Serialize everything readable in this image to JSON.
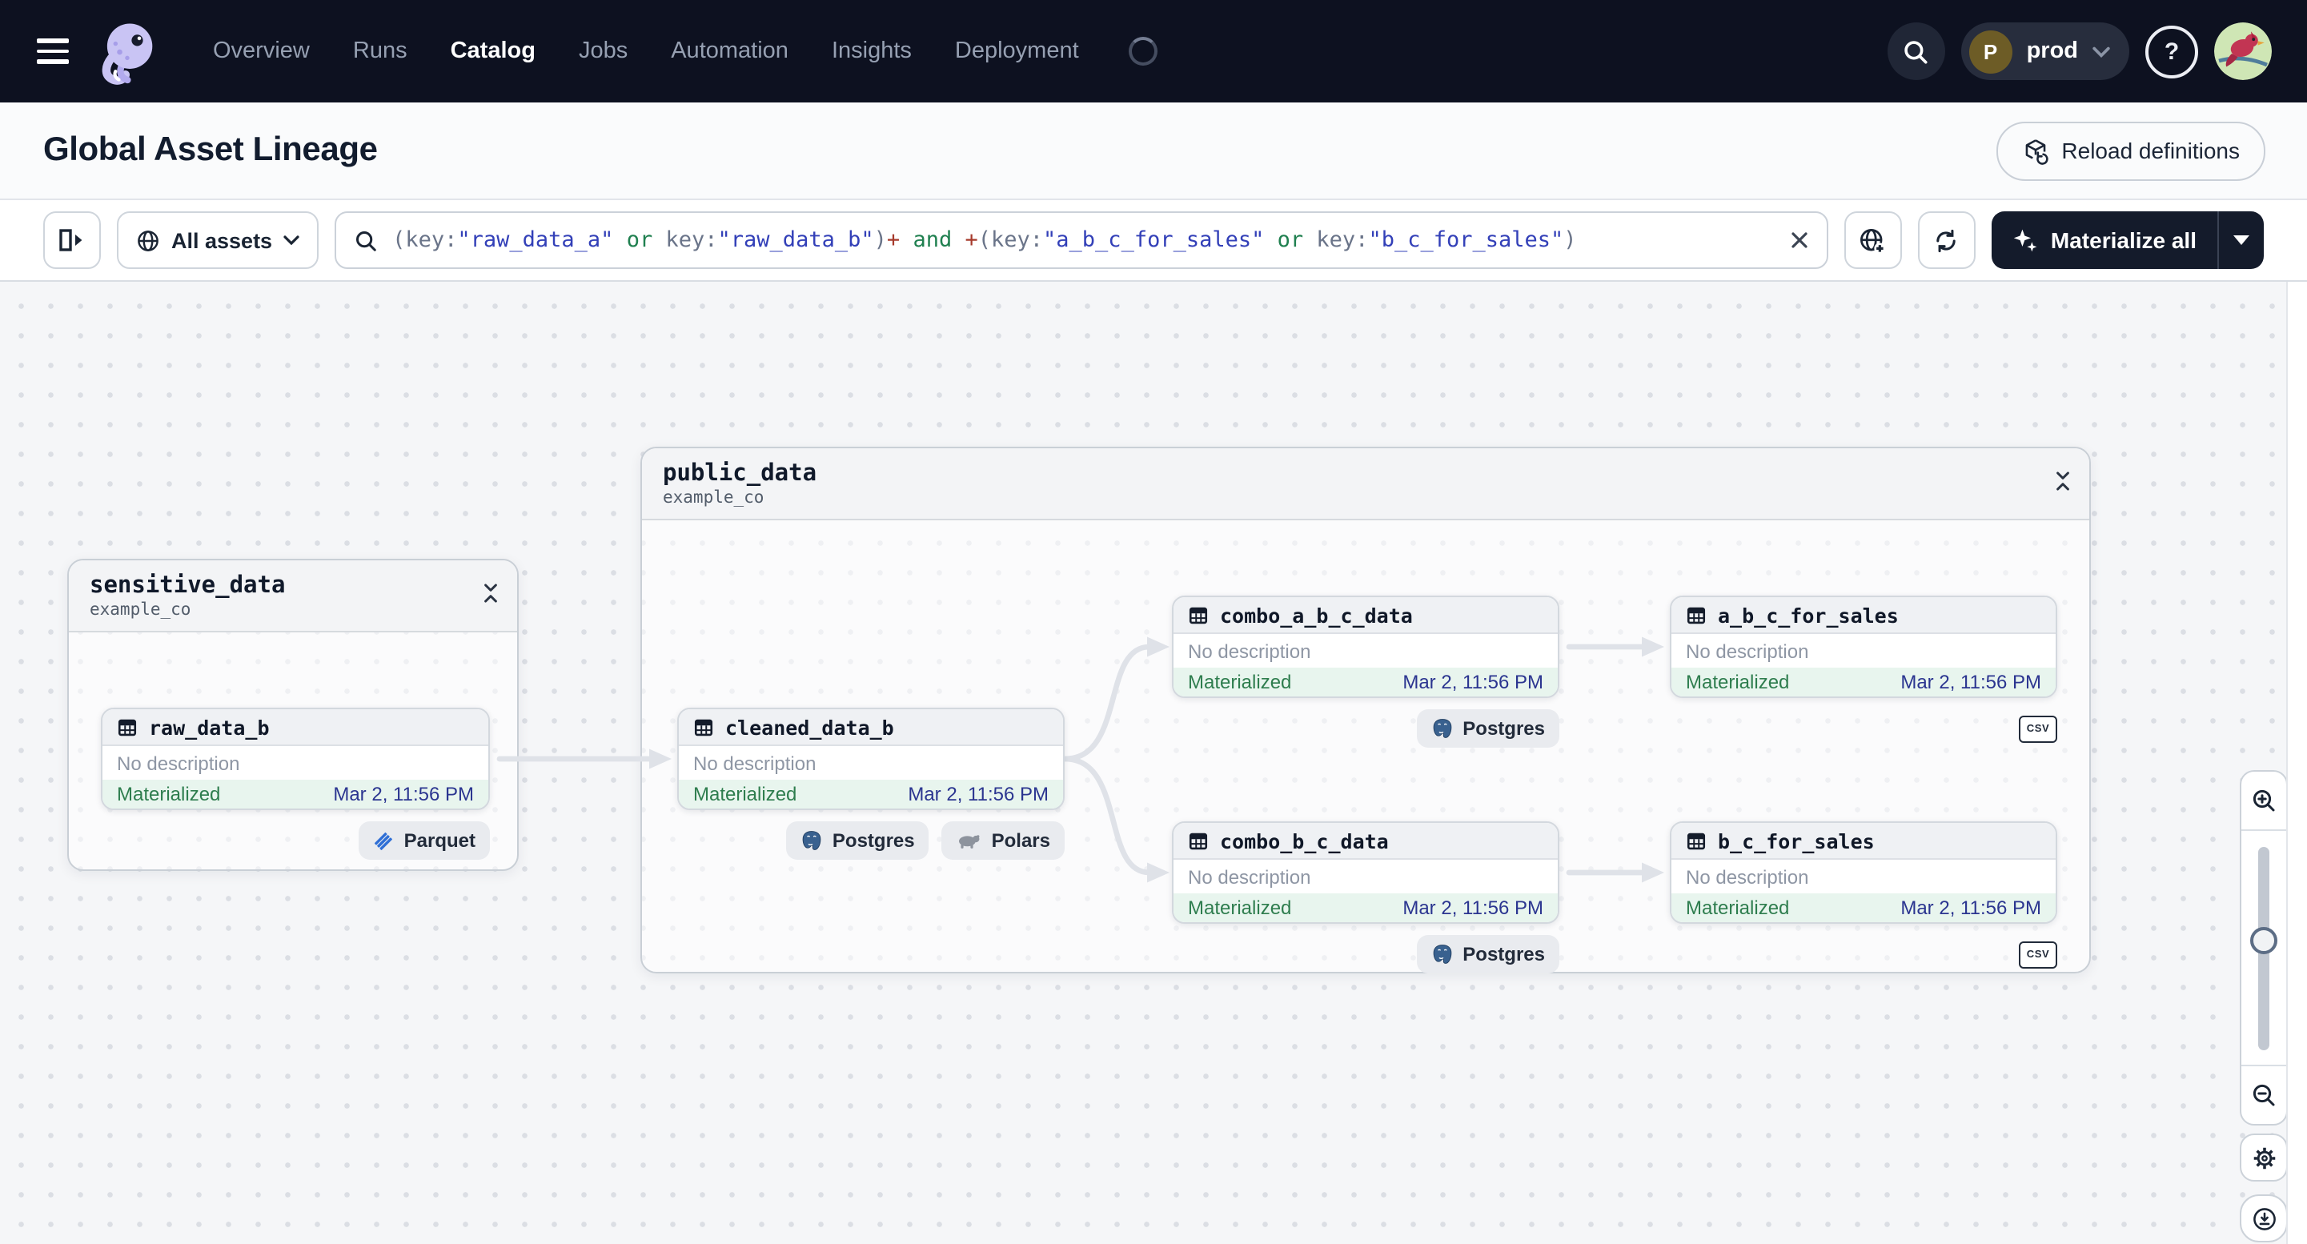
{
  "nav": {
    "items": [
      {
        "label": "Overview"
      },
      {
        "label": "Runs"
      },
      {
        "label": "Catalog"
      },
      {
        "label": "Jobs"
      },
      {
        "label": "Automation"
      },
      {
        "label": "Insights"
      },
      {
        "label": "Deployment"
      }
    ],
    "deployment_initial": "P",
    "deployment_name": "prod"
  },
  "header": {
    "title": "Global Asset Lineage",
    "reload_button": "Reload definitions"
  },
  "toolbar": {
    "scope_button": "All assets",
    "materialize_button": "Materialize all",
    "query": {
      "segments": [
        {
          "text": "(key:"
        },
        {
          "text": "\"raw_data_a\""
        },
        {
          "text": " or "
        },
        {
          "text": "key:"
        },
        {
          "text": "\"raw_data_b\""
        },
        {
          "text": ")"
        },
        {
          "text": "+"
        },
        {
          "text": " and "
        },
        {
          "text": "+"
        },
        {
          "text": "(key:"
        },
        {
          "text": "\"a_b_c_for_sales\""
        },
        {
          "text": " or "
        },
        {
          "text": "key:"
        },
        {
          "text": "\"b_c_for_sales\""
        },
        {
          "text": ")"
        }
      ]
    }
  },
  "graph": {
    "groups": [
      {
        "name": "sensitive_data",
        "repo": "example_co"
      },
      {
        "name": "public_data",
        "repo": "example_co"
      }
    ],
    "nodes": [
      {
        "name": "raw_data_b",
        "description": "No description",
        "status": "Materialized",
        "timestamp": "Mar 2, 11:56 PM",
        "tags": [
          "Parquet"
        ]
      },
      {
        "name": "cleaned_data_b",
        "description": "No description",
        "status": "Materialized",
        "timestamp": "Mar 2, 11:56 PM",
        "tags": [
          "Postgres",
          "Polars"
        ]
      },
      {
        "name": "combo_a_b_c_data",
        "description": "No description",
        "status": "Materialized",
        "timestamp": "Mar 2, 11:56 PM",
        "tags": [
          "Postgres"
        ]
      },
      {
        "name": "a_b_c_for_sales",
        "description": "No description",
        "status": "Materialized",
        "timestamp": "Mar 2, 11:56 PM",
        "tags": [
          "CSV"
        ]
      },
      {
        "name": "combo_b_c_data",
        "description": "No description",
        "status": "Materialized",
        "timestamp": "Mar 2, 11:56 PM",
        "tags": [
          "Postgres"
        ]
      },
      {
        "name": "b_c_for_sales",
        "description": "No description",
        "status": "Materialized",
        "timestamp": "Mar 2, 11:56 PM",
        "tags": [
          "CSV"
        ]
      }
    ]
  },
  "icons": {
    "search": "magnifier",
    "help": "question-mark-circle",
    "menu": "hamburger",
    "clear": "x-mark",
    "scope": "globe",
    "new_tab": "globe-plus",
    "refresh": "circular-arrows",
    "materialize": "sparkles",
    "collapse": "double-chevron-inward",
    "asset": "table-grid",
    "zoom_in": "magnifier-plus",
    "zoom_out": "magnifier-minus",
    "settings": "gear",
    "export": "download-circle"
  },
  "colors": {
    "nav_background": "#0d1120",
    "materialized_green": "#2e7d4e",
    "timestamp_navy": "#2b3590",
    "query_string": "#3340b8",
    "query_operator": "#208050",
    "query_plus": "#a63a2b",
    "edge_gray": "#dfe2e8"
  }
}
